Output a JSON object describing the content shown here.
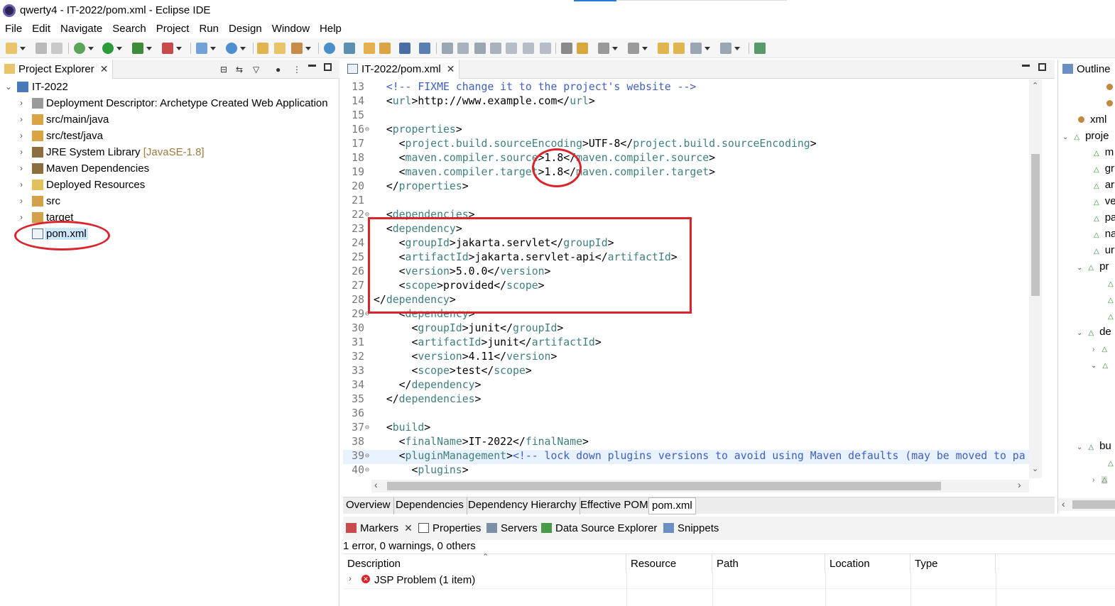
{
  "window": {
    "title": "qwerty4 - IT-2022/pom.xml - Eclipse IDE"
  },
  "menu": [
    "File",
    "Edit",
    "Navigate",
    "Search",
    "Project",
    "Run",
    "Design",
    "Window",
    "Help"
  ],
  "project_explorer": {
    "tab_label": "Project Explorer",
    "tree": [
      {
        "label": "IT-2022",
        "decoration": "",
        "icon": "web-project-icon"
      },
      {
        "label": "Deployment Descriptor: Archetype Created Web Application",
        "decoration": "",
        "icon": "deployment-descriptor-icon"
      },
      {
        "label": "src/main/java",
        "decoration": "",
        "icon": "source-folder-icon"
      },
      {
        "label": "src/test/java",
        "decoration": "",
        "icon": "source-folder-icon"
      },
      {
        "label": "JRE System Library",
        "decoration": "[JavaSE-1.8]",
        "icon": "library-icon"
      },
      {
        "label": "Maven Dependencies",
        "decoration": "",
        "icon": "library-icon"
      },
      {
        "label": "Deployed Resources",
        "decoration": "",
        "icon": "deployed-resources-icon"
      },
      {
        "label": "src",
        "decoration": "",
        "icon": "folder-icon"
      },
      {
        "label": "target",
        "decoration": "",
        "icon": "folder-icon"
      },
      {
        "label": "pom.xml",
        "decoration": "",
        "icon": "xml-file-icon"
      }
    ]
  },
  "editor": {
    "tab_label": "IT-2022/pom.xml",
    "lines": [
      {
        "n": "13",
        "text": "  <!-- FIXME change it to the project's website -->"
      },
      {
        "n": "14",
        "text": "  <url>http://www.example.com</url>"
      },
      {
        "n": "15",
        "text": ""
      },
      {
        "n": "16",
        "text": "  <properties>"
      },
      {
        "n": "17",
        "text": "    <project.build.sourceEncoding>UTF-8</project.build.sourceEncoding>"
      },
      {
        "n": "18",
        "text": "    <maven.compiler.source>1.8</maven.compiler.source>"
      },
      {
        "n": "19",
        "text": "    <maven.compiler.target>1.8</maven.compiler.target>"
      },
      {
        "n": "20",
        "text": "  </properties>"
      },
      {
        "n": "21",
        "text": ""
      },
      {
        "n": "22",
        "text": "  <dependencies>"
      },
      {
        "n": "23",
        "text": "  <dependency>"
      },
      {
        "n": "24",
        "text": "    <groupId>jakarta.servlet</groupId>"
      },
      {
        "n": "25",
        "text": "    <artifactId>jakarta.servlet-api</artifactId>"
      },
      {
        "n": "26",
        "text": "    <version>5.0.0</version>"
      },
      {
        "n": "27",
        "text": "    <scope>provided</scope>"
      },
      {
        "n": "28",
        "text": "</dependency>"
      },
      {
        "n": "29",
        "text": "    <dependency>"
      },
      {
        "n": "30",
        "text": "      <groupId>junit</groupId>"
      },
      {
        "n": "31",
        "text": "      <artifactId>junit</artifactId>"
      },
      {
        "n": "32",
        "text": "      <version>4.11</version>"
      },
      {
        "n": "33",
        "text": "      <scope>test</scope>"
      },
      {
        "n": "34",
        "text": "    </dependency>"
      },
      {
        "n": "35",
        "text": "  </dependencies>"
      },
      {
        "n": "36",
        "text": ""
      },
      {
        "n": "37",
        "text": "  <build>"
      },
      {
        "n": "38",
        "text": "    <finalName>IT-2022</finalName>"
      },
      {
        "n": "39",
        "text": "    <pluginManagement><!-- lock down plugins versions to avoid using Maven defaults (may be moved to pa"
      },
      {
        "n": "40",
        "text": "      <plugins>"
      }
    ],
    "bottom_tabs": [
      "Overview",
      "Dependencies",
      "Dependency Hierarchy",
      "Effective POM",
      "pom.xml"
    ],
    "active_bottom_tab": "pom.xml"
  },
  "markers": {
    "tabs": [
      "Markers",
      "Properties",
      "Servers",
      "Data Source Explorer",
      "Snippets"
    ],
    "status": "1 error, 0 warnings, 0 others",
    "columns": [
      "Description",
      "Resource",
      "Path",
      "Location",
      "Type"
    ],
    "rows": [
      {
        "description": "JSP Problem (1 item)",
        "severity": "error"
      }
    ]
  },
  "outline": {
    "tab_label": "Outline",
    "items": [
      "xml",
      "proje",
      "m",
      "gr",
      "ar",
      "ve",
      "pa",
      "na",
      "ur",
      "pr",
      "de",
      "bu"
    ]
  },
  "colors": {
    "tag": "#3f7f7f",
    "comment": "#3f5fbf",
    "annotation": "#d9242c",
    "selection": "#cce8ff"
  }
}
